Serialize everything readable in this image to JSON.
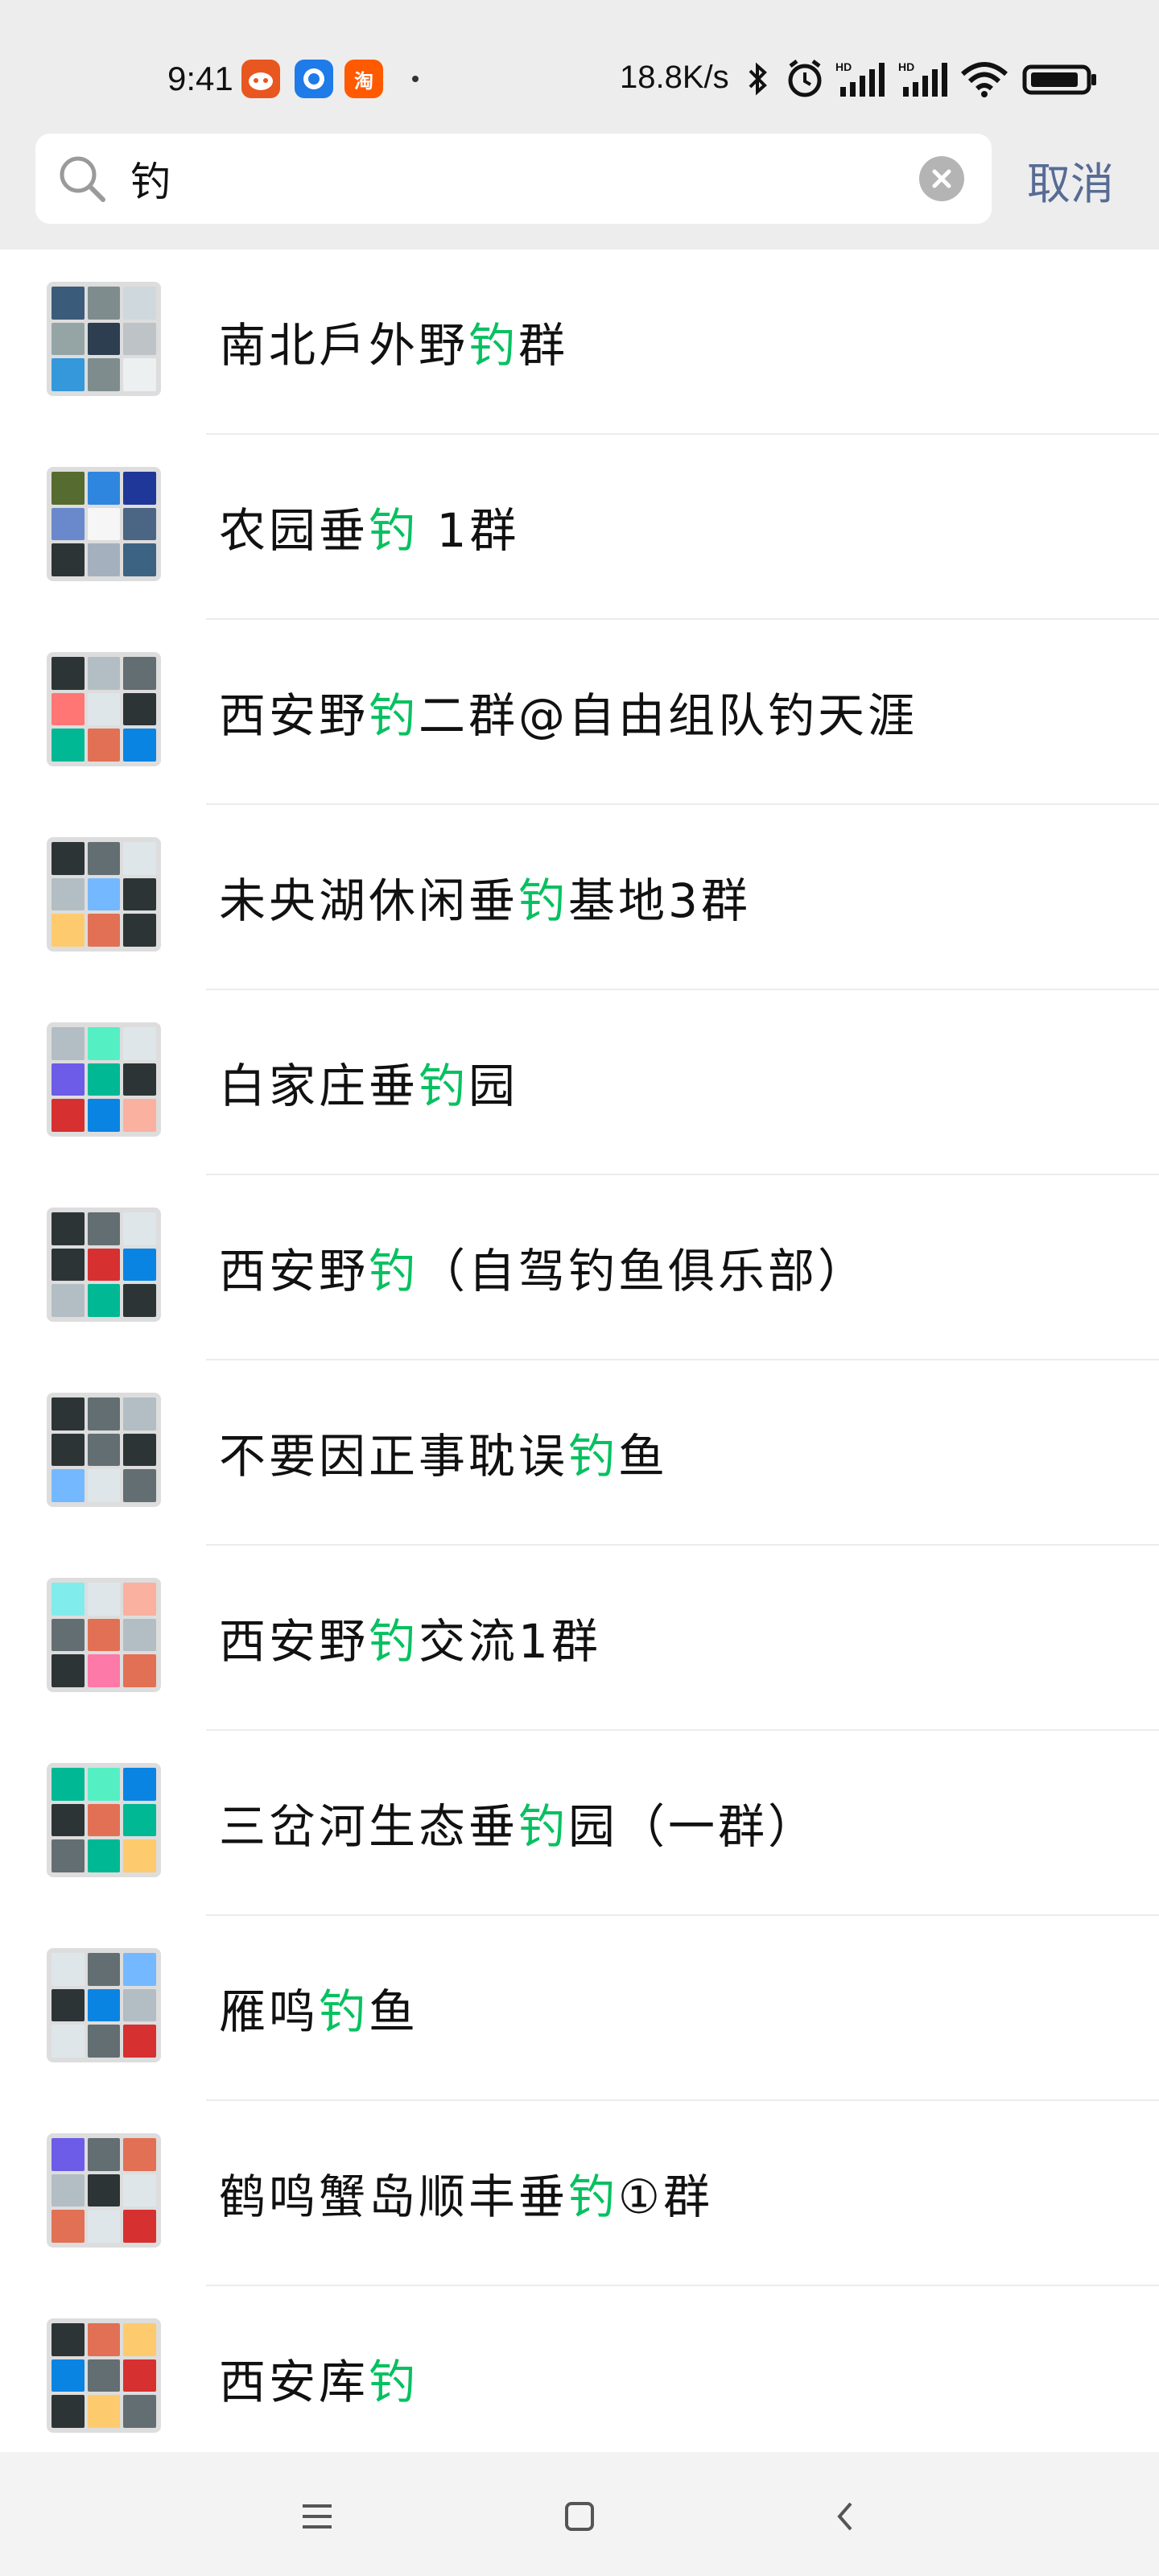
{
  "status_bar": {
    "time": "9:41",
    "net_speed": "18.8K/s",
    "icons": [
      "app-icon-orange",
      "app-icon-blue",
      "app-icon-taobao",
      "bluetooth-icon",
      "alarm-icon",
      "signal-hd-icon",
      "signal-hd-icon",
      "wifi-icon",
      "battery-icon"
    ],
    "taobao_glyph": "淘"
  },
  "search": {
    "query": "钓",
    "cancel_label": "取消"
  },
  "colors": {
    "highlight": "#07c160",
    "cancel": "#576b95",
    "background": "#ededed"
  },
  "results": [
    {
      "pre": "南北戶外野",
      "hl": "钓",
      "post": "群"
    },
    {
      "pre": "农园垂",
      "hl": "钓",
      "post": " 1群"
    },
    {
      "pre": "西安野",
      "hl": "钓",
      "post": "二群@自由组队钓天涯"
    },
    {
      "pre": "未央湖休闲垂",
      "hl": "钓",
      "post": "基地3群"
    },
    {
      "pre": "白家庄垂",
      "hl": "钓",
      "post": "园"
    },
    {
      "pre": "西安野",
      "hl": "钓",
      "post": "（自驾钓鱼俱乐部）"
    },
    {
      "pre": "不要因正事耽误",
      "hl": "钓",
      "post": "鱼"
    },
    {
      "pre": "西安野",
      "hl": "钓",
      "post": "交流1群"
    },
    {
      "pre": "三岔河生态垂",
      "hl": "钓",
      "post": "园（一群）"
    },
    {
      "pre": "雁鸣",
      "hl": "钓",
      "post": "鱼"
    },
    {
      "pre": "鹤鸣蟹岛顺丰垂",
      "hl": "钓",
      "post": "①群"
    },
    {
      "pre": "西安库",
      "hl": "钓",
      "post": ""
    }
  ],
  "nav": {
    "buttons": [
      "menu-icon",
      "home-icon",
      "back-icon"
    ]
  }
}
